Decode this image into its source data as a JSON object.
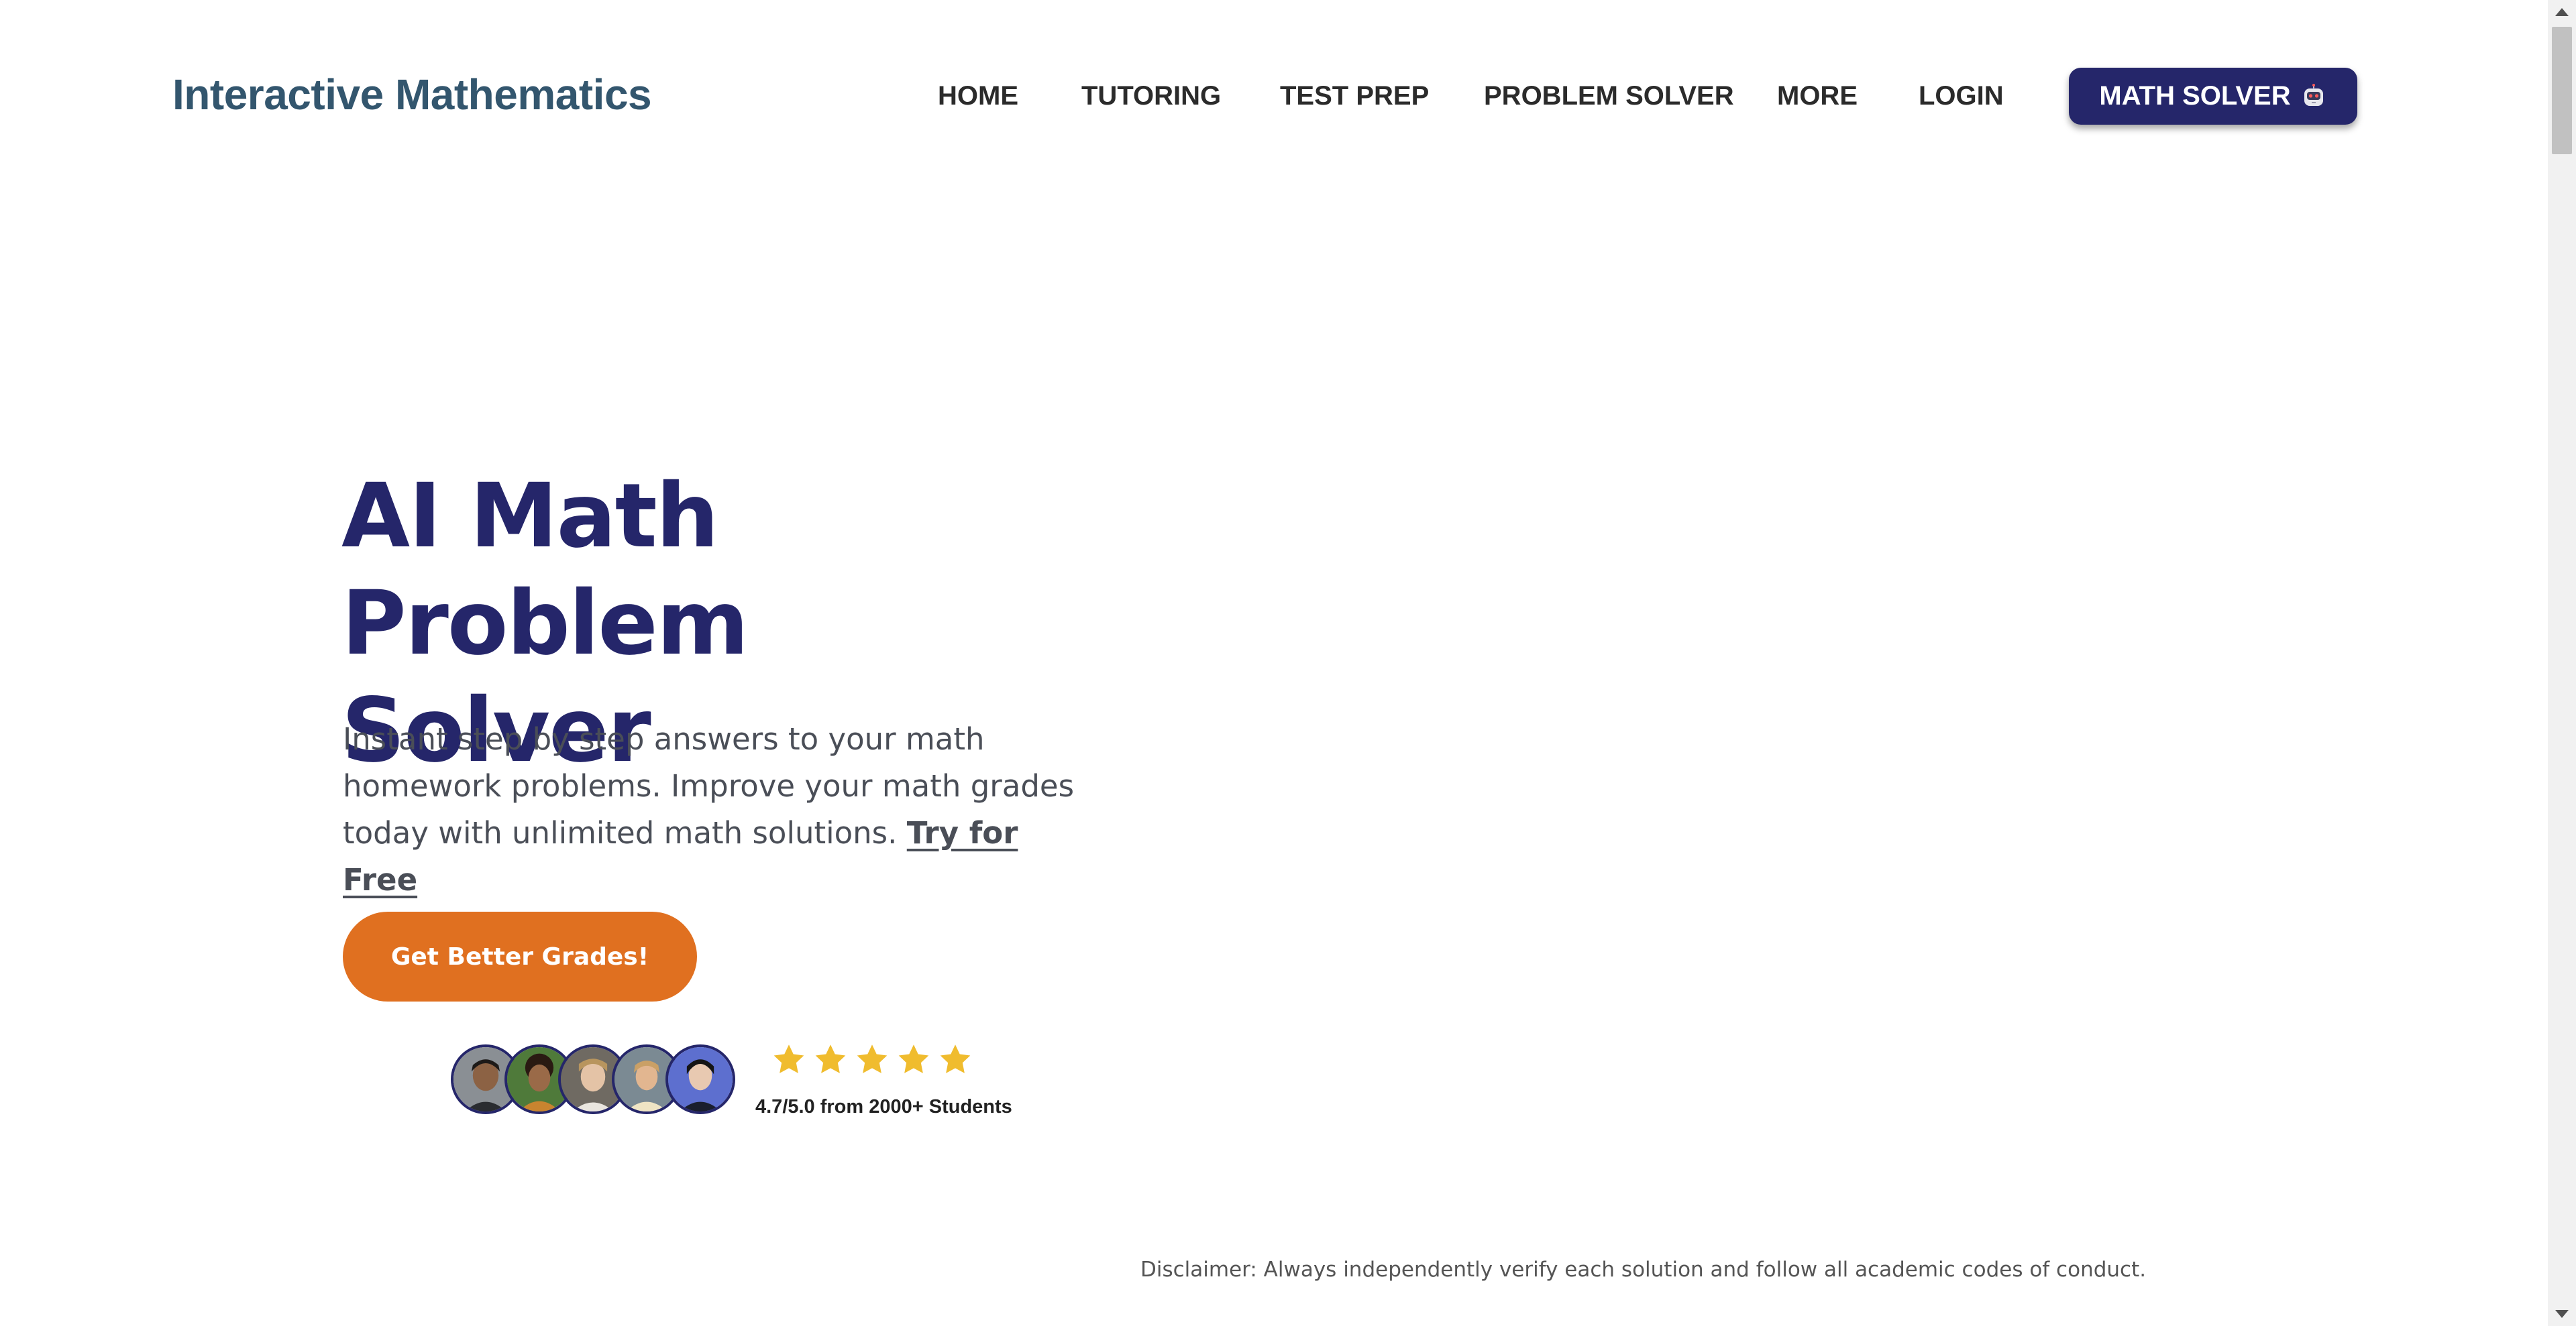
{
  "header": {
    "logo": "Interactive Mathematics",
    "nav": [
      {
        "label": "HOME"
      },
      {
        "label": "TUTORING"
      },
      {
        "label": "TEST PREP"
      },
      {
        "label": "PROBLEM SOLVER"
      },
      {
        "label": "MORE"
      },
      {
        "label": "LOGIN"
      }
    ],
    "cta_label": "MATH SOLVER",
    "cta_icon": "robot-icon"
  },
  "hero": {
    "title_line1": "AI Math Problem",
    "title_line2": "Solver",
    "description": "Instant step by step answers to your math homework problems. Improve your math grades today with unlimited math solutions.",
    "try_link": "Try for Free",
    "button_label": "Get Better Grades!",
    "rating": {
      "stars": 5,
      "text": "4.7/5.0 from 2000+ Students"
    },
    "avatar_count": 5
  },
  "disclaimer": "Disclaimer: Always independently verify each solution and follow all academic codes of conduct.",
  "colors": {
    "brand_navy": "#25266a",
    "logo_slate": "#33566e",
    "cta_orange": "#e07020",
    "star_gold": "#f0bc2e"
  }
}
